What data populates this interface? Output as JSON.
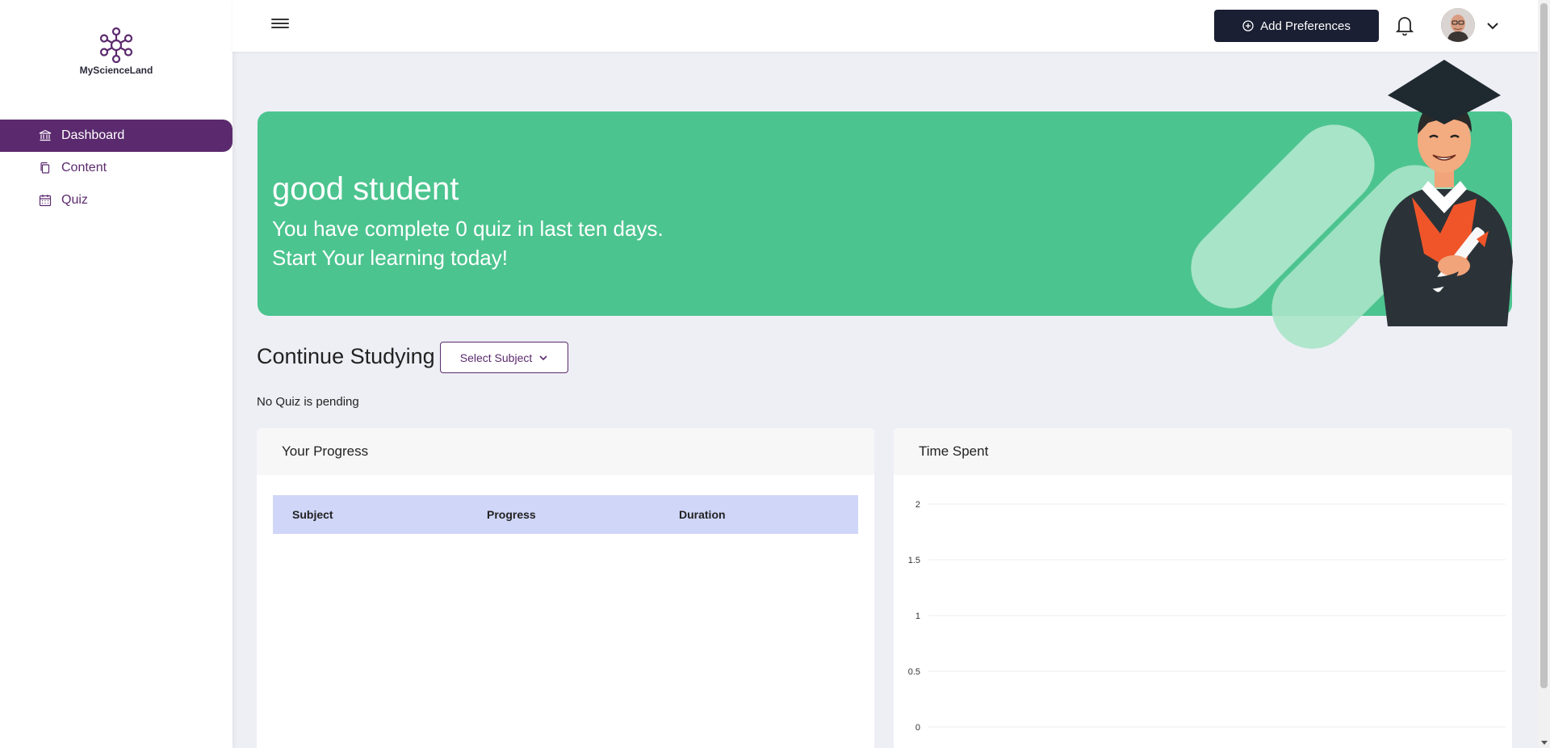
{
  "brand": {
    "name": "MyScienceLand",
    "color": "#5b2a6e"
  },
  "sidebar": {
    "items": [
      {
        "label": "Dashboard",
        "icon": "bank-icon",
        "active": true
      },
      {
        "label": "Content",
        "icon": "copy-icon",
        "active": false
      },
      {
        "label": "Quiz",
        "icon": "calendar-icon",
        "active": false
      }
    ]
  },
  "header": {
    "add_preferences_label": "Add Preferences",
    "icons": [
      "menu-icon",
      "plus-circle-icon",
      "bell-icon",
      "chevron-down-icon"
    ]
  },
  "banner": {
    "title": "good student",
    "line1": "You have complete 0 quiz in last ten days.",
    "line2": "Start Your learning today!",
    "color": "#4cc48f"
  },
  "continue": {
    "title": "Continue Studying",
    "select_label": "Select Subject",
    "empty_text": "No Quiz is pending"
  },
  "progress_card": {
    "title": "Your Progress",
    "columns": [
      "Subject",
      "Progress",
      "Duration"
    ],
    "rows": []
  },
  "time_card": {
    "title": "Time Spent"
  },
  "chart_data": {
    "type": "line",
    "title": "",
    "xlabel": "",
    "ylabel": "",
    "ylim": [
      0,
      2
    ],
    "yticks": [
      "2",
      "1.5",
      "1",
      "0.5",
      "0"
    ],
    "series": [],
    "grid": true
  }
}
